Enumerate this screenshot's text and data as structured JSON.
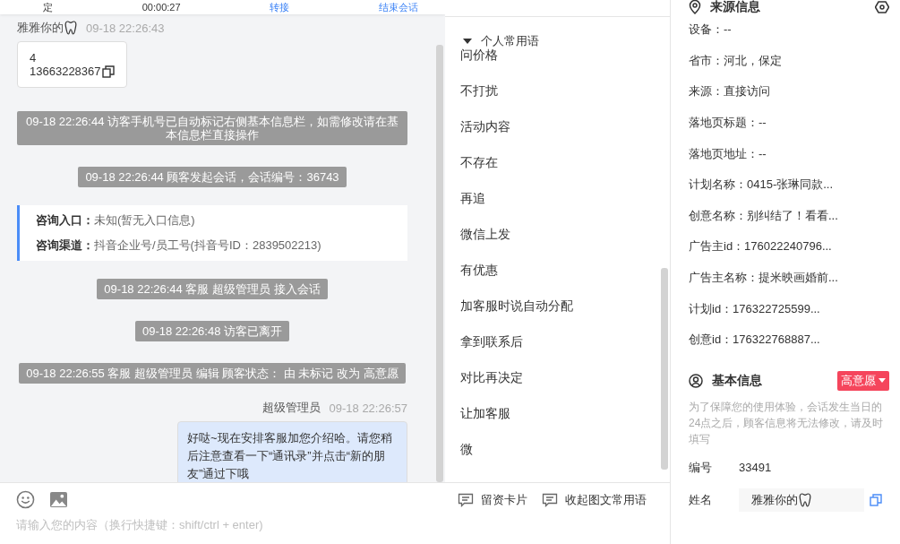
{
  "header": {
    "items": [
      {
        "kind": "text",
        "text": "定"
      },
      {
        "kind": "text",
        "text": "00:00:27"
      },
      {
        "kind": "link",
        "text": "转接"
      },
      {
        "kind": "link",
        "text": "结束会话"
      }
    ]
  },
  "chat": {
    "messages": [
      {
        "kind": "customer",
        "name": "雅雅你的",
        "time": "09-18 22:26:43",
        "lines": [
          "4",
          "13663228367"
        ]
      },
      {
        "kind": "system",
        "text": "09-18 22:26:44 访客手机号已自动标记右侧基本信息栏，如需修改请在基本信息栏直接操作"
      },
      {
        "kind": "system",
        "text": "09-18 22:26:44 顾客发起会话，会话编号：36743"
      },
      {
        "kind": "entry",
        "fields": [
          {
            "label": "咨询入口：",
            "value": "未知(暂无入口信息)"
          },
          {
            "label": "咨询渠道：",
            "value": "抖音企业号/员工号(抖音号ID：2839502213)"
          }
        ]
      },
      {
        "kind": "system",
        "text": "09-18 22:26:44 客服 超级管理员 接入会话"
      },
      {
        "kind": "system",
        "text": "09-18 22:26:48 访客已离开"
      },
      {
        "kind": "system",
        "text": "09-18 22:26:55 客服 超级管理员 编辑 顾客状态： 由 未标记 改为 高意愿"
      },
      {
        "kind": "agent",
        "name": "超级管理员",
        "time": "09-18 22:26:57",
        "text": "好哒~现在安排客服加您介绍哈。请您稍后注意查看一下“通讯录”并点击“新的朋友”通过下哦"
      }
    ]
  },
  "phrases": {
    "group": {
      "title": "个人常用语",
      "expanded": true
    },
    "items": [
      "问价格",
      "不打扰",
      "活动内容",
      "不存在",
      "再追",
      "微信上发",
      "有优惠",
      "加客服时说自动分配",
      "拿到联系后",
      "对比再决定",
      "让加客服",
      "微"
    ]
  },
  "composer": {
    "actions": [
      "留资卡片",
      "收起图文常用语"
    ],
    "placeholder": "请输入您的内容（换行快捷键：shift/ctrl + enter)"
  },
  "source_info": {
    "title": "来源信息",
    "items": [
      "设备：--",
      "省市：河北，保定",
      "来源：直接访问",
      "落地页标题：--",
      "落地页地址：--",
      "计划名称：0415-张琳同款...",
      "创意名称：别纠结了！看看...",
      "广告主id：176022240796...",
      "广告主名称：提米映画婚前...",
      "计划id：176322725599...",
      "创意id：176322768887..."
    ]
  },
  "basic_info": {
    "title": "基本信息",
    "intent": {
      "label": "高意愿",
      "color": "#f5455c"
    },
    "note": "为了保障您的使用体验，会话发生当日的24点之后，顾客信息将无法修改，请及时填写",
    "fields": [
      {
        "kind": "text",
        "label": "编号",
        "value": "33491"
      },
      {
        "kind": "input",
        "label": "姓名",
        "value": "雅雅你的"
      }
    ]
  }
}
